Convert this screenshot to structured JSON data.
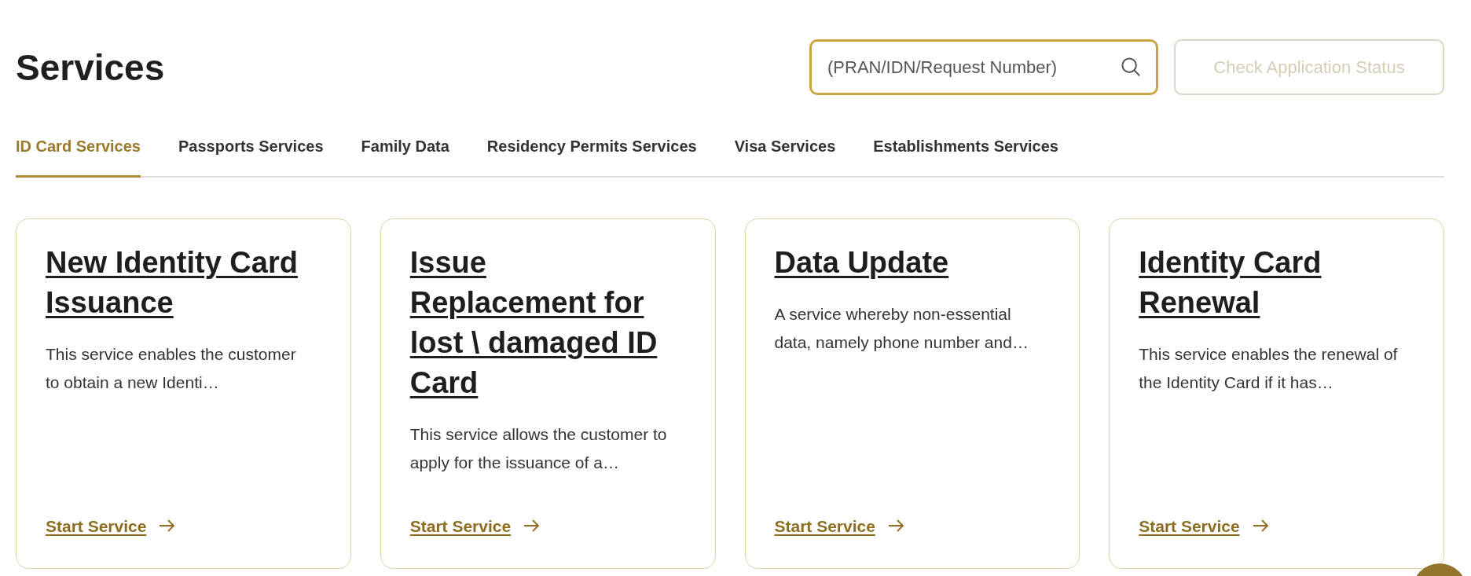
{
  "page_title": "Services",
  "search": {
    "placeholder": "(PRAN/IDN/Request Number)"
  },
  "status_button": {
    "label": "Check Application Status",
    "disabled": true
  },
  "tabs": [
    {
      "label": "ID Card Services",
      "selected": true
    },
    {
      "label": "Passports Services",
      "selected": false
    },
    {
      "label": "Family Data",
      "selected": false
    },
    {
      "label": "Residency Permits Services",
      "selected": false
    },
    {
      "label": "Visa Services",
      "selected": false
    },
    {
      "label": "Establishments Services",
      "selected": false
    }
  ],
  "cards": [
    {
      "title": "New Identity Card Issuance",
      "description": "This service enables the customer to obtain a new Identi…",
      "link": "Start Service"
    },
    {
      "title": "Issue Replacement for lost \\ damaged ID Card",
      "description": "This service allows the customer to apply for the issuance of a…",
      "link": "Start Service"
    },
    {
      "title": "Data Update",
      "description": "A service whereby non-essential data, namely phone number and…",
      "link": "Start Service"
    },
    {
      "title": "Identity Card Renewal",
      "description": "This service enables the renewal of the Identity Card if it has…",
      "link": "Start Service"
    }
  ]
}
